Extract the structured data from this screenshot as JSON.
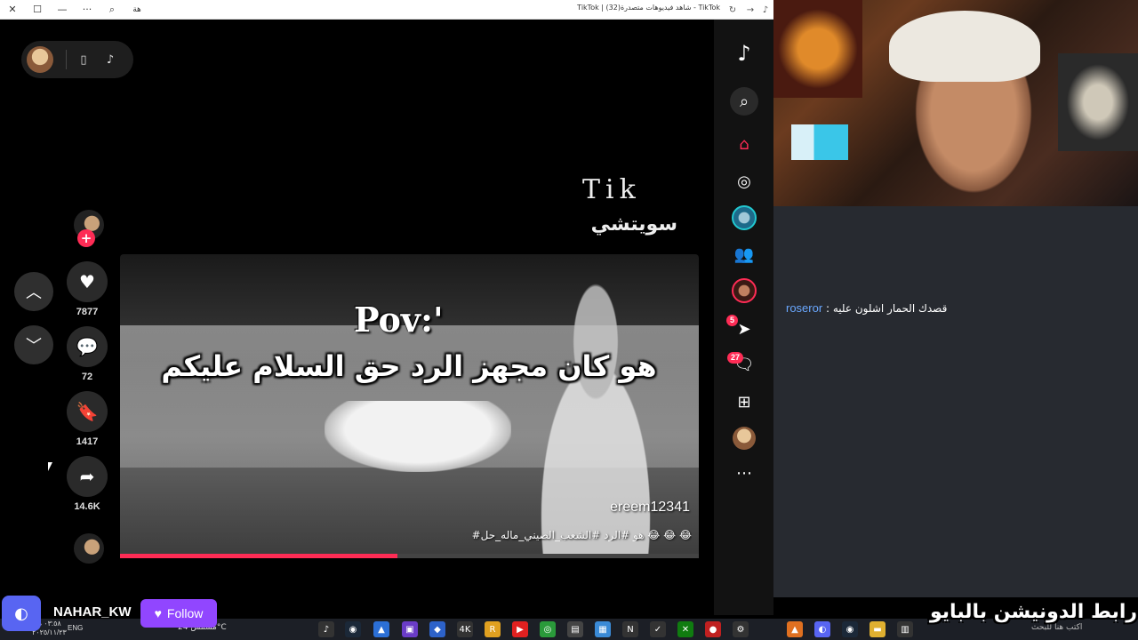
{
  "browser": {
    "tab_title": "TikTok | شاهد فيديوهات متصدرة(32) - TikTok",
    "ai_label": "هة"
  },
  "video": {
    "overlay_brand": "Tik",
    "overlay_brand_sub": "سويتشي",
    "pov_label": "Pov:'",
    "caption": "هو كان مجهز الرد حق السلام عليكم",
    "username": "ereem12341",
    "hashtags": "#هو #الرد #الشعب_الصيني_ماله_حل 😂 😂 😂",
    "progress": 0.48
  },
  "actions": {
    "likes": "7877",
    "comments": "72",
    "saves": "1417",
    "shares": "14.6K"
  },
  "sidebar": {
    "inbox_badge": "5",
    "messages_badge": "27"
  },
  "stream": {
    "chat_user": "roseror",
    "chat_text": " : قصدك الحمار اشلون عليه",
    "handle": "NAHAR_KW",
    "follow_label": "Follow",
    "donation_banner": "رابط الدونيشن بالبايو"
  },
  "taskbar": {
    "lang": "ENG",
    "weather": "مشمس 24°C",
    "time": "٠٣:٥٨ م",
    "date": "٢٠٢٥/١١/٢٣",
    "search_placeholder": "اكتب هنا للبحث"
  },
  "colors": {
    "accent": "#fe2c55",
    "twitch": "#9146ff",
    "discord": "#5865f2"
  }
}
